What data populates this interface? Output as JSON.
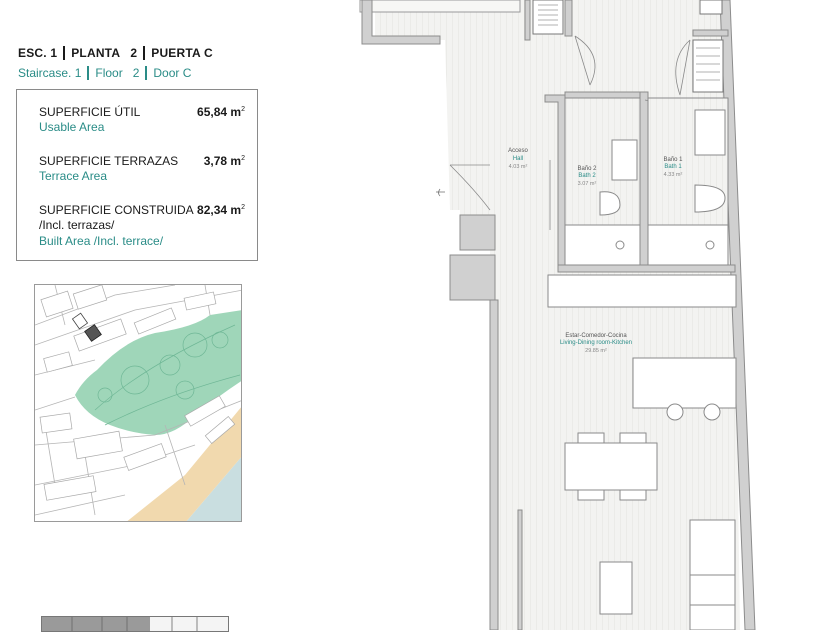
{
  "header": {
    "esc_label": "ESC. 1",
    "planta_label": "PLANTA   2",
    "puerta_label": "PUERTA C",
    "staircase_label": "Staircase. 1",
    "floor_label": "Floor   2",
    "door_label": "Door C"
  },
  "areas": [
    {
      "label_es": "SUPERFICIE ÚTIL",
      "label_en": "Usable Area",
      "value": "65,84 m",
      "unit_exp": "2"
    },
    {
      "label_es": "SUPERFICIE TERRAZAS",
      "label_en": "Terrace Area",
      "value": "3,78 m",
      "unit_exp": "2"
    },
    {
      "label_es": "SUPERFICIE CONSTRUIDA",
      "label_es_2": "/Incl. terrazas/",
      "label_en": "Built Area /Incl. terrace/",
      "value": "82,34 m",
      "unit_exp": "2"
    }
  ],
  "rooms": {
    "hall": {
      "name_es": "Acceso",
      "name_en": "Hall",
      "area": "4.03 m²"
    },
    "bath2": {
      "name_es": "Baño 2",
      "name_en": "Bath 2",
      "area": "3.07 m²"
    },
    "bath1": {
      "name_es": "Baño 1",
      "name_en": "Bath 1",
      "area": "4.33 m²"
    },
    "living": {
      "name_es": "Estar-Comedor-Cocina",
      "name_en": "Living-Dining room-Kitchen",
      "area": "29.85 m²"
    }
  },
  "colors": {
    "teal_text": "#2a8c87",
    "green_park": "#9fd6b9",
    "sand": "#f1d9ae",
    "sea": "#c9dee0",
    "wall": "#cfcfcf",
    "floor_hatch": "#ececea"
  }
}
